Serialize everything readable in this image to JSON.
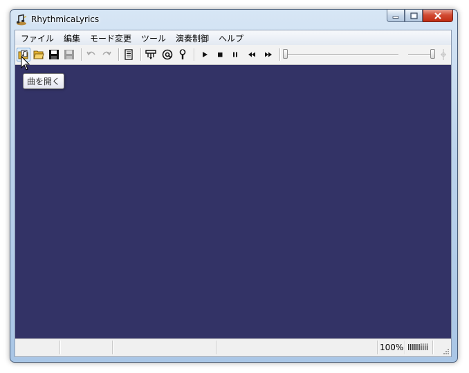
{
  "window": {
    "title": "RhythmicaLyrics",
    "app_icon": "music-notes-icon"
  },
  "menu": [
    {
      "label": "ファイル"
    },
    {
      "label": "編集"
    },
    {
      "label": "モード変更"
    },
    {
      "label": "ツール"
    },
    {
      "label": "演奏制御"
    },
    {
      "label": "ヘルプ"
    }
  ],
  "toolbar": {
    "buttons": [
      {
        "icon": "open-song-icon",
        "active": true
      },
      {
        "icon": "open-folder-icon"
      },
      {
        "icon": "save-icon"
      },
      {
        "icon": "save-as-icon",
        "disabled": true
      },
      {
        "icon": "undo-icon",
        "disabled": true
      },
      {
        "icon": "redo-icon",
        "disabled": true
      },
      {
        "icon": "document-icon"
      },
      {
        "icon": "tune-icon"
      },
      {
        "icon": "at-sign-icon"
      },
      {
        "icon": "wrench-icon"
      },
      {
        "icon": "play-icon"
      },
      {
        "icon": "stop-icon"
      },
      {
        "icon": "pause-icon"
      },
      {
        "icon": "rewind-icon"
      },
      {
        "icon": "fast-forward-icon"
      }
    ],
    "position_slider": 0,
    "volume_slider": 1
  },
  "tooltip": {
    "text": "曲を開く"
  },
  "canvas": {
    "background": "#333366"
  },
  "status": {
    "zoom": "100%",
    "level": "IIIIIIiiii"
  }
}
